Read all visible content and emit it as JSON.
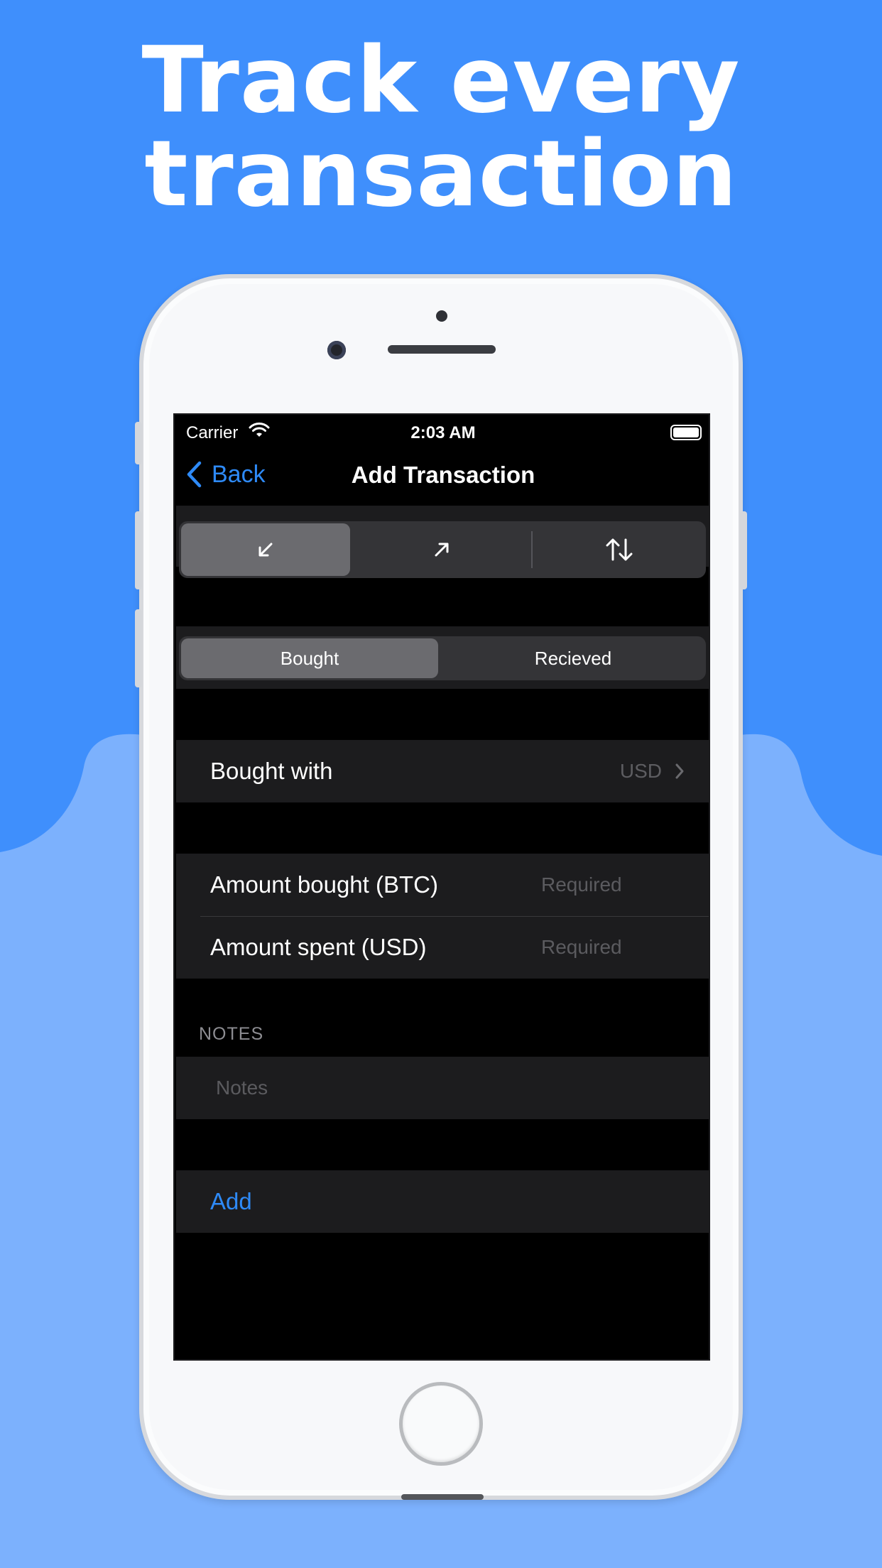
{
  "headline": {
    "line1": "Track every",
    "line2": "transaction"
  },
  "colors": {
    "background_top": "#3f8ffc",
    "background_bottom": "#7cb1fd",
    "accent": "#2e8af7"
  },
  "status_bar": {
    "carrier": "Carrier",
    "time": "2:03 AM"
  },
  "nav": {
    "back_label": "Back",
    "title": "Add Transaction"
  },
  "direction_segment": {
    "items": [
      {
        "icon": "arrow-down-left-icon",
        "selected": true
      },
      {
        "icon": "arrow-up-right-icon",
        "selected": false
      },
      {
        "icon": "arrows-up-down-icon",
        "selected": false
      }
    ]
  },
  "type_segment": {
    "items": [
      {
        "label": "Bought",
        "selected": true
      },
      {
        "label": "Recieved",
        "selected": false
      }
    ]
  },
  "bought_with": {
    "label": "Bought with",
    "value": "USD"
  },
  "amount_bought": {
    "label": "Amount bought (BTC)",
    "placeholder": "Required"
  },
  "amount_spent": {
    "label": "Amount spent (USD)",
    "placeholder": "Required"
  },
  "notes": {
    "header": "NOTES",
    "placeholder": "Notes"
  },
  "add_button": {
    "label": "Add"
  }
}
